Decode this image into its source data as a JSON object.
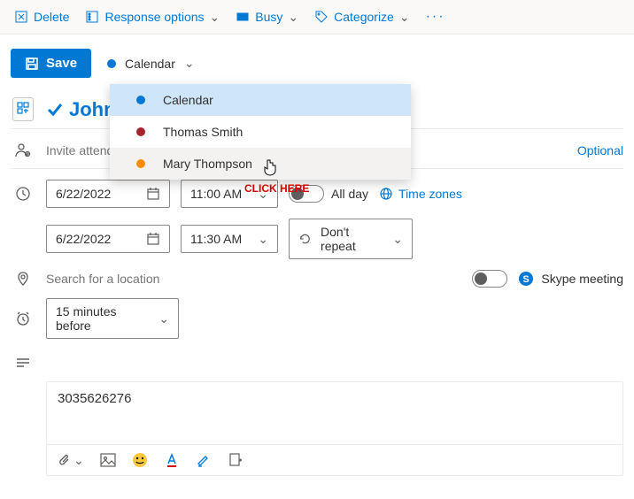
{
  "toolbar": {
    "delete": "Delete",
    "response": "Response options",
    "busy": "Busy",
    "categorize": "Categorize"
  },
  "save_label": "Save",
  "calendar_selector": {
    "label": "Calendar",
    "color": "#0078d4"
  },
  "dropdown": [
    {
      "label": "Calendar",
      "color": "#0078d4",
      "state": "selected"
    },
    {
      "label": "Thomas Smith",
      "color": "#a4262c",
      "state": ""
    },
    {
      "label": "Mary Thompson",
      "color": "#ff8c00",
      "state": "hover"
    }
  ],
  "title": "John",
  "attendees_placeholder": "Invite attendees",
  "optional_label": "Optional",
  "start_date": "6/22/2022",
  "start_time": "11:00 AM",
  "end_date": "6/22/2022",
  "end_time": "11:30 AM",
  "all_day_label": "All day",
  "time_zones_label": "Time zones",
  "repeat_label": "Don't repeat",
  "location_placeholder": "Search for a location",
  "skype_label": "Skype meeting",
  "reminder_label": "15 minutes before",
  "description": "3035626276",
  "click_here": "CLICK HERE"
}
